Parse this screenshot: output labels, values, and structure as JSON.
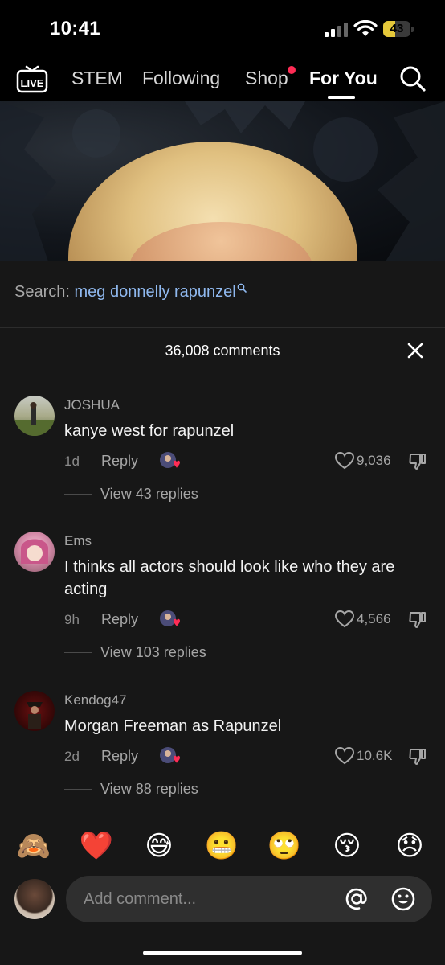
{
  "status_bar": {
    "time": "10:41",
    "battery_level": "43",
    "battery_percent": 43,
    "battery_color": "#e5c83a"
  },
  "top_nav": {
    "live_label": "LIVE",
    "tabs": [
      {
        "label": "STEM"
      },
      {
        "label": "Following"
      },
      {
        "label": "Shop",
        "badge": true
      },
      {
        "label": "For You",
        "active": true
      }
    ],
    "badge_color": "#fe2c55",
    "search_icon": "search-icon"
  },
  "search_suggestion": {
    "label": "Search:",
    "query": "meg donnelly rapunzel"
  },
  "comments_header": {
    "count_text": "36,008 comments",
    "close_icon": "close-icon"
  },
  "comments": [
    {
      "user": "JOSHUA",
      "text": "kanye west for rapunzel",
      "time": "1d",
      "reply_label": "Reply",
      "likes": "9,036",
      "view_replies": "View 43 replies"
    },
    {
      "user": "Ems",
      "text": "I thinks all actors should look like who they are acting",
      "time": "9h",
      "reply_label": "Reply",
      "likes": "4,566",
      "view_replies": "View 103 replies"
    },
    {
      "user": "Kendog47",
      "text": "Morgan Freeman as Rapunzel",
      "time": "2d",
      "reply_label": "Reply",
      "likes": "10.6K",
      "view_replies": "View 88 replies"
    }
  ],
  "emoji_bar": [
    "🙈",
    "❤️",
    "😅",
    "😬",
    "🙄",
    "😚",
    "😞"
  ],
  "comment_input": {
    "placeholder": "Add comment...",
    "mention_icon": "at-icon",
    "emoji_icon": "emoji-icon"
  },
  "colors": {
    "sheet_background": "#171717",
    "search_query": "#8fb8ee",
    "accent_red": "#fe2c55"
  }
}
